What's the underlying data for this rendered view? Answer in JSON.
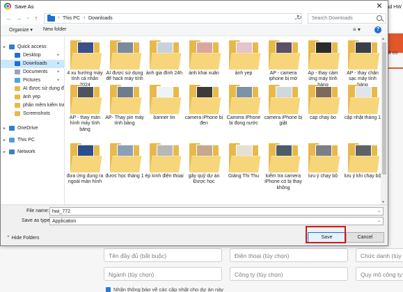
{
  "background": {
    "side_texts": [
      "load HW",
      "nhà cu"
    ],
    "fields": [
      {
        "placeholder": "Tên đầy đủ (bắt buộc)"
      },
      {
        "placeholder": "Điện thoại (tùy chọn)"
      },
      {
        "placeholder": "Chức danh (tùy c"
      },
      {
        "placeholder": "Ngành (tùy chọn)"
      },
      {
        "placeholder": "Công ty (tùy chọn)"
      },
      {
        "placeholder": "Quy mô công ty: (t"
      }
    ],
    "checkbox_label": "Nhận thông báo về các cập nhật cho dự án này"
  },
  "dialog": {
    "title": "Save As",
    "close_glyph": "✕",
    "nav": {
      "back": "←",
      "forward": "→",
      "up_chevron": "⌄",
      "up": "↑",
      "breadcrumb": [
        "This PC",
        "Downloads"
      ],
      "separator": "›",
      "dropdown": "⌄",
      "refresh": "↻",
      "search_placeholder": "Search Downloads"
    },
    "toolbar": {
      "organize": "Organize ▾",
      "new_folder": "New folder",
      "view_glyph": "≡ ▾",
      "help": "?"
    },
    "navpane": [
      {
        "label": "Quick access",
        "caret": "▸",
        "pin": false,
        "selected": false,
        "icon": "star-icon",
        "color": "#2f7dd8"
      },
      {
        "label": "Desktop",
        "caret": "",
        "pin": true,
        "selected": false,
        "icon": "desktop-icon",
        "color": "#1f6fd1"
      },
      {
        "label": "Downloads",
        "caret": "",
        "pin": true,
        "selected": true,
        "icon": "download-icon",
        "color": "#1f6fd1"
      },
      {
        "label": "Documents",
        "caret": "",
        "pin": true,
        "selected": false,
        "icon": "documents-icon",
        "color": "#9aa5b1"
      },
      {
        "label": "Pictures",
        "caret": "",
        "pin": true,
        "selected": false,
        "icon": "pictures-icon",
        "color": "#4aa3df"
      },
      {
        "label": "AI được sử dụng để",
        "caret": "",
        "pin": false,
        "selected": false,
        "icon": "folder-icon",
        "color": "#e8b94a"
      },
      {
        "label": "ảnh yep",
        "caret": "",
        "pin": false,
        "selected": false,
        "icon": "folder-icon",
        "color": "#e8b94a"
      },
      {
        "label": "phần mềm kiểm tra",
        "caret": "",
        "pin": false,
        "selected": false,
        "icon": "folder-icon",
        "color": "#e8b94a"
      },
      {
        "label": "Screenshots",
        "caret": "",
        "pin": false,
        "selected": false,
        "icon": "folder-icon",
        "color": "#e8b94a"
      },
      {
        "label": "OneDrive",
        "caret": "▸",
        "pin": false,
        "selected": false,
        "icon": "onedrive-icon",
        "color": "#2f7dd8"
      },
      {
        "label": "This PC",
        "caret": "▸",
        "pin": false,
        "selected": false,
        "icon": "pc-icon",
        "color": "#5a9bd5"
      },
      {
        "label": "Network",
        "caret": "▸",
        "pin": false,
        "selected": false,
        "icon": "network-icon",
        "color": "#3c7fc4"
      }
    ],
    "pin_glyph": "✦",
    "files": [
      {
        "label": "4 xu hướng máy tính cá nhân 2024",
        "thumb": "#3d4f8a"
      },
      {
        "label": "AI được sử dụng để hack máy tính",
        "thumb": "#7a8b9c"
      },
      {
        "label": "ảnh gia đình 24h",
        "thumb": "#c7d3dc"
      },
      {
        "label": "ảnh khai xuân",
        "thumb": "#d9a7a0"
      },
      {
        "label": "ảnh yep",
        "thumb": "#e7c3cb"
      },
      {
        "label": "AP - camera iphone bị mờ",
        "thumb": "#5b5066"
      },
      {
        "label": "Ap - thay cảm ứng máy tính bảng",
        "thumb": "#2b2b2b"
      },
      {
        "label": "AP - thay chân sạc máy tính bảng",
        "thumb": "#3a3f48"
      },
      {
        "label": "AP - thay màn hình máy tính bảng",
        "thumb": "#4b5560"
      },
      {
        "label": "AP- Thay pin máy tính bảng",
        "thumb": "#6d7d8a"
      },
      {
        "label": "banner tin",
        "thumb": "#eef3f6"
      },
      {
        "label": "camera iPhone bị đen",
        "thumb": "#3a3a3a"
      },
      {
        "label": "Camera iPhone bị đọng nước",
        "thumb": "#7c93a6"
      },
      {
        "label": "camera iPhone bị giật",
        "thumb": "#cfd8de"
      },
      {
        "label": "cap chay bo",
        "thumb": "#7e6a5c"
      },
      {
        "label": "cập nhật tháng 1",
        "thumb": "#dfe5ea"
      },
      {
        "label": "đưa ứng dụng ra ngoài màn hình",
        "thumb": "#2c4f8c"
      },
      {
        "label": "đươc học tháng 1",
        "thumb": "#8aa0b8"
      },
      {
        "label": "ép kính điện thoại",
        "thumb": "#b8b8b8"
      },
      {
        "label": "gây quỹ dự án Được học",
        "thumb": "#c4a98f"
      },
      {
        "label": "Giáng Thi Thu",
        "thumb": "#e6dfd4"
      },
      {
        "label": "kiểm tra camera iPhone có bị thay không",
        "thumb": "#4c5c6b"
      },
      {
        "label": "lưu ý chạy bộ",
        "thumb": "#7b7f86"
      },
      {
        "label": "lưu ý khi chạy bộ",
        "thumb": "#5f6368"
      }
    ],
    "file_name_label": "File name:",
    "file_name_value": "hwi_772",
    "save_as_type_label": "Save as type:",
    "save_as_type_value": "Application",
    "dropdown_glyph": "⌄",
    "hide_folders": "⌃  Hide Folders",
    "save_button": "Save",
    "cancel_button": "Cancel",
    "colors": {
      "accent": "#0078d7",
      "highlight": "#d81414",
      "folder": "#e8b94a"
    }
  }
}
